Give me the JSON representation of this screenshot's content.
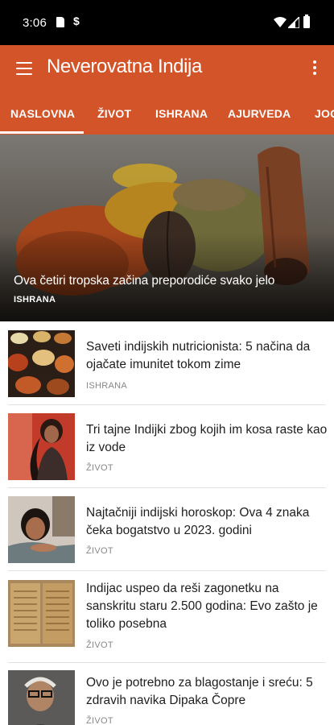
{
  "status_bar": {
    "time": "3:06",
    "icons": [
      "sim-card-icon",
      "data-saver-icon",
      "wifi-icon",
      "signal-icon",
      "battery-icon"
    ]
  },
  "app_bar": {
    "title": "Neverovatna Indija",
    "background": "#d4542a"
  },
  "tabs": [
    {
      "label": "NASLOVNA",
      "selected": true
    },
    {
      "label": "ŽIVOT",
      "selected": false
    },
    {
      "label": "ISHRANA",
      "selected": false
    },
    {
      "label": "AJURVEDA",
      "selected": false
    },
    {
      "label": "JOG",
      "selected": false
    }
  ],
  "hero": {
    "title": "Ova četiri tropska začina preporodiće svako jelo",
    "category": "ISHRANA"
  },
  "articles": [
    {
      "title": "Saveti indijskih nutricionista: 5 načina da ojačate imunitet tokom zime",
      "category": "ISHRANA"
    },
    {
      "title": "Tri tajne Indijki zbog kojih im kosa raste kao iz vode",
      "category": "ŽIVOT"
    },
    {
      "title": "Najtačniji indijski horoskop: Ova 4 znaka čeka bogatstvo u 2023. godini",
      "category": "ŽIVOT"
    },
    {
      "title": "Indijac uspeo da reši zagonetku na sanskritu staru 2.500 godina: Evo zašto je toliko posebna",
      "category": "ŽIVOT"
    },
    {
      "title": "Ovo je potrebno za blagostanje i sreću: 5 zdravih navika Dipaka Čopre",
      "category": "ŽIVOT"
    }
  ]
}
